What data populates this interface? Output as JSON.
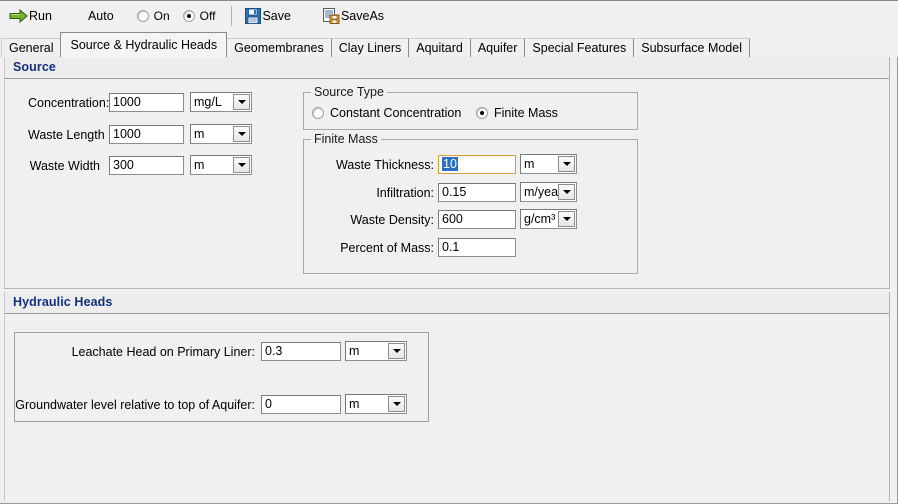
{
  "toolbar": {
    "run_label": "Run",
    "auto_label": "Auto",
    "on_label": "On",
    "off_label": "Off",
    "save_label": "Save",
    "saveas_label": "SaveAs",
    "auto_selected": "Off",
    "run_icon": "green-right-arrow-icon",
    "save_icon": "floppy-disk-icon",
    "saveas_icon": "save-as-icon"
  },
  "tabs": {
    "selected": "Source & Hydraulic Heads",
    "items": [
      {
        "label": "General"
      },
      {
        "label": "Source & Hydraulic Heads"
      },
      {
        "label": "Geomembranes"
      },
      {
        "label": "Clay Liners"
      },
      {
        "label": "Aquitard"
      },
      {
        "label": "Aquifer"
      },
      {
        "label": "Special Features"
      },
      {
        "label": "Subsurface Model"
      }
    ]
  },
  "source": {
    "title": "Source",
    "fields": {
      "concentration": {
        "label": "Concentration:",
        "value": "1000",
        "unit": "mg/L"
      },
      "waste_length": {
        "label": "Waste Length",
        "value": "1000",
        "unit": "m"
      },
      "waste_width": {
        "label": "Waste Width",
        "value": "300",
        "unit": "m"
      }
    },
    "source_type": {
      "title": "Source Type",
      "constant_concentration": "Constant Concentration",
      "finite_mass": "Finite Mass",
      "selected": "Finite Mass"
    },
    "finite_mass": {
      "title": "Finite Mass",
      "waste_thickness": {
        "label": "Waste Thickness:",
        "value": "10",
        "unit": "m",
        "selected_text": "10"
      },
      "infiltration": {
        "label": "Infiltration:",
        "value": "0.15",
        "unit": "m/year"
      },
      "waste_density": {
        "label": "Waste Density:",
        "value": "600",
        "unit": "g/cm³"
      },
      "percent_of_mass": {
        "label": "Percent of Mass:",
        "value": "0.1"
      }
    }
  },
  "hydraulic_heads": {
    "title": "Hydraulic Heads",
    "leachate_head": {
      "label": "Leachate Head on Primary Liner:",
      "value": "0.3",
      "unit": "m"
    },
    "groundwater_level": {
      "label": "Groundwater level relative to top of Aquifer:",
      "value": "0",
      "unit": "m"
    }
  },
  "colors": {
    "section_title": "#14307c",
    "focus_border": "#d79b3a",
    "selection": "#2a6fc4",
    "run_arrow": "#5fa01e",
    "save_blue": "#2c6fb5",
    "window_bg": "#f0f0f0"
  }
}
